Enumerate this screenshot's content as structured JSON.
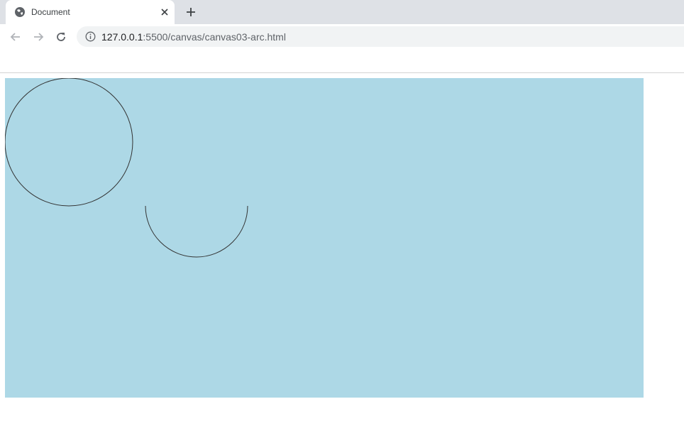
{
  "tab": {
    "title": "Document",
    "favicon": "globe-icon",
    "close_icon": "close-icon"
  },
  "new_tab_icon": "plus-icon",
  "toolbar": {
    "back_icon": "arrow-left-icon",
    "forward_icon": "arrow-right-icon",
    "reload_icon": "reload-icon",
    "info_icon": "info-icon",
    "url_host": "127.0.0.1",
    "url_rest": ":5500/canvas/canvas03-arc.html"
  },
  "colors": {
    "canvas_background": "#add8e6",
    "stroke": "#333333",
    "tabstrip": "#dee1e6",
    "omnibox": "#f1f3f4"
  }
}
